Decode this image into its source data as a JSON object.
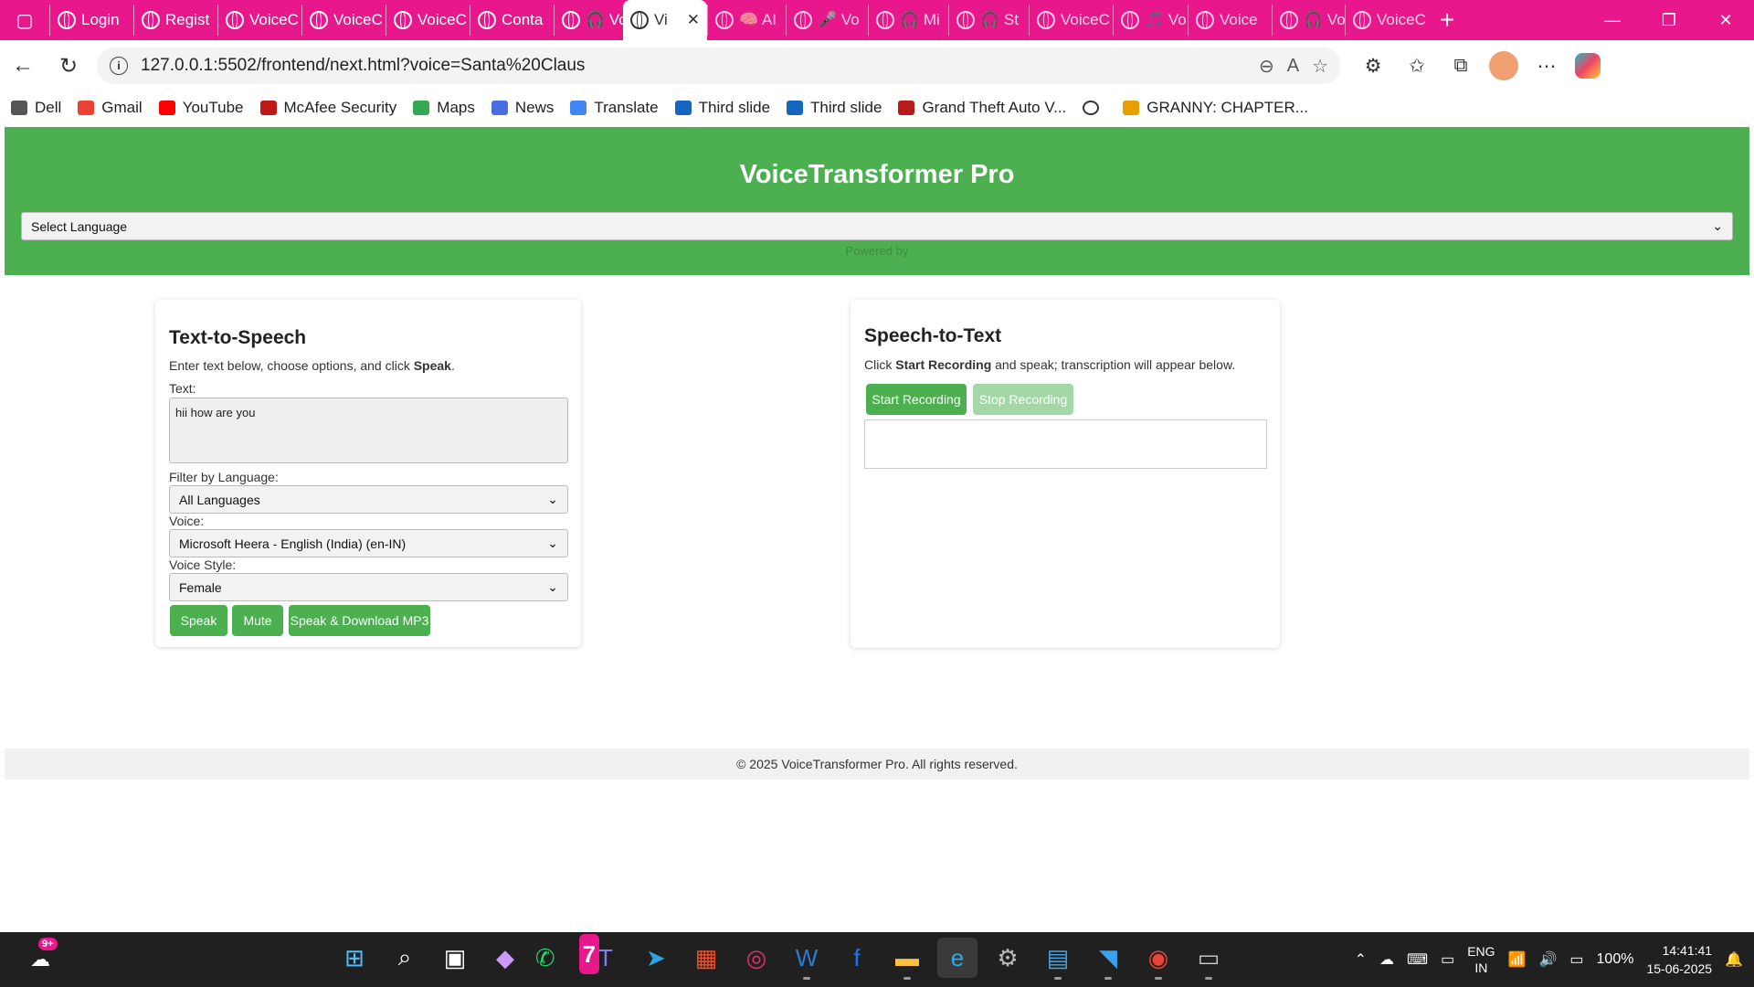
{
  "browser": {
    "tabs": [
      {
        "label": "Login",
        "icon": "globe-icon"
      },
      {
        "label": "Regist",
        "icon": "globe-icon"
      },
      {
        "label": "VoiceC",
        "icon": "globe-icon"
      },
      {
        "label": "VoiceC",
        "icon": "globe-icon"
      },
      {
        "label": "VoiceC",
        "icon": "globe-icon"
      },
      {
        "label": "Conta",
        "icon": "globe-icon"
      },
      {
        "label": "🎧 Vo",
        "icon": "globe-icon"
      },
      {
        "label": "Vi",
        "icon": "globe-icon",
        "active": true
      },
      {
        "label": "🧠 AI",
        "icon": "globe-icon"
      },
      {
        "label": "🎤 Vo",
        "icon": "globe-icon"
      },
      {
        "label": "🎧 Mi",
        "icon": "globe-icon"
      },
      {
        "label": "🎧 St",
        "icon": "globe-icon"
      },
      {
        "label": "VoiceC",
        "icon": "globe-icon"
      },
      {
        "label": "🎵 Vo",
        "icon": "globe-icon"
      },
      {
        "label": "Voice",
        "icon": "globe-icon"
      },
      {
        "label": "🎧 Vo",
        "icon": "globe-icon"
      },
      {
        "label": "VoiceC",
        "icon": "globe-icon"
      }
    ],
    "url": "127.0.0.1:5502/frontend/next.html?voice=Santa%20Claus",
    "bookmarks": [
      {
        "label": "Dell",
        "color": "#555555"
      },
      {
        "label": "Gmail",
        "color": "#ea4335"
      },
      {
        "label": "YouTube",
        "color": "#ff0000"
      },
      {
        "label": "McAfee Security",
        "color": "#c01818"
      },
      {
        "label": "Maps",
        "color": "#34a853"
      },
      {
        "label": "News",
        "color": "#4a6ee0"
      },
      {
        "label": "Translate",
        "color": "#4285f4"
      },
      {
        "label": "Third slide",
        "color": "#1565c0"
      },
      {
        "label": "Third slide",
        "color": "#1565c0"
      },
      {
        "label": "Grand Theft Auto V...",
        "color": "#b71c1c"
      },
      {
        "label": "",
        "color": "#333333"
      },
      {
        "label": "GRANNY: CHAPTER...",
        "color": "#e6a100"
      }
    ]
  },
  "app": {
    "title": "VoiceTransformer Pro",
    "language_select": "Select Language",
    "powered_by": "Powered by",
    "accent": "#4caf50"
  },
  "tts": {
    "heading": "Text-to-Speech",
    "intro_prefix": "Enter text below, choose options, and click ",
    "intro_bold": "Speak",
    "intro_suffix": ".",
    "text_label": "Text:",
    "text_value": "hii how are you",
    "filter_label": "Filter by Language:",
    "filter_value": "All Languages",
    "voice_label": "Voice:",
    "voice_value": "Microsoft Heera - English (India) (en-IN)",
    "style_label": "Voice Style:",
    "style_value": "Female",
    "speak_button": "Speak",
    "mute_button": "Mute",
    "download_button": "Speak & Download MP3"
  },
  "stt": {
    "heading": "Speech-to-Text",
    "intro_prefix": "Click ",
    "intro_bold": "Start Recording",
    "intro_suffix": " and speak; transcription will appear below.",
    "start_button": "Start Recording",
    "stop_button": "Stop Recording",
    "transcript": ""
  },
  "footer": {
    "text": "© 2025 VoiceTransformer Pro. All rights reserved."
  },
  "taskbar": {
    "notification_badge": "9+",
    "whatsapp_badge": "7",
    "language": "ENG",
    "region": "IN",
    "battery": "100%",
    "time": "14:41:41",
    "date": "15-06-2025"
  }
}
